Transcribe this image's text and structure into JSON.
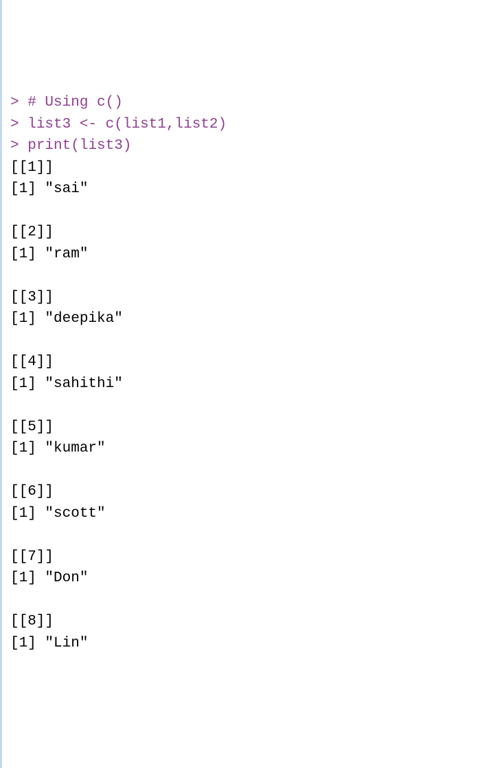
{
  "code": {
    "line1": {
      "prompt": "> ",
      "comment": "# Using c()"
    },
    "line2": {
      "prompt": "> ",
      "var1": "list3 ",
      "op": "<- ",
      "func": "c",
      "lparen": "(",
      "arg1": "list1",
      "comma": ",",
      "arg2": "list2",
      "rparen": ")"
    },
    "line3": {
      "prompt": "> ",
      "func": "print",
      "lparen": "(",
      "arg": "list3",
      "rparen": ")"
    }
  },
  "output": {
    "items": [
      {
        "index": "[[1]]",
        "value": "[1] \"sai\""
      },
      {
        "index": "[[2]]",
        "value": "[1] \"ram\""
      },
      {
        "index": "[[3]]",
        "value": "[1] \"deepika\""
      },
      {
        "index": "[[4]]",
        "value": "[1] \"sahithi\""
      },
      {
        "index": "[[5]]",
        "value": "[1] \"kumar\""
      },
      {
        "index": "[[6]]",
        "value": "[1] \"scott\""
      },
      {
        "index": "[[7]]",
        "value": "[1] \"Don\""
      },
      {
        "index": "[[8]]",
        "value": "[1] \"Lin\""
      }
    ]
  }
}
